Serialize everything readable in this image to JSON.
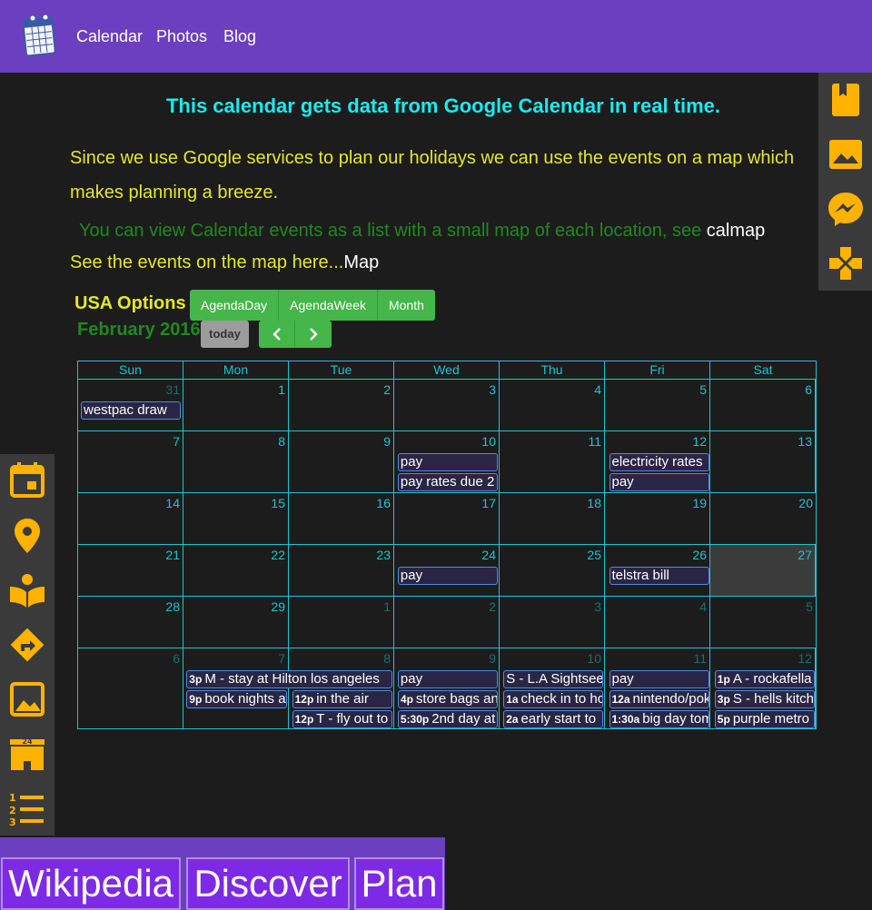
{
  "nav": {
    "links": [
      "Calendar",
      "Photos",
      "Blog"
    ]
  },
  "headline": "This calendar gets data from Google Calendar in real time.",
  "intro": "Since we use Google services to plan our holidays we can use the events on a map which makes planning a breeze.",
  "list_line": {
    "text": "You can view Calendar events as a list with a small map of each location, see ",
    "link": "calmap"
  },
  "map_line": {
    "text": "See the events on the map here...",
    "link": "Map"
  },
  "calendar": {
    "options_label": "USA Options",
    "views": [
      "AgendaDay",
      "AgendaWeek",
      "Month"
    ],
    "title": "February 2016",
    "today_label": "today",
    "weekdays": [
      "Sun",
      "Mon",
      "Tue",
      "Wed",
      "Thu",
      "Fri",
      "Sat"
    ],
    "weeks": [
      {
        "days": [
          {
            "n": "31",
            "other": true
          },
          {
            "n": "1"
          },
          {
            "n": "2"
          },
          {
            "n": "3"
          },
          {
            "n": "4"
          },
          {
            "n": "5"
          },
          {
            "n": "6"
          }
        ],
        "events": [
          {
            "col": 0,
            "lane": 0,
            "title": "westpac draw"
          }
        ]
      },
      {
        "days": [
          {
            "n": "7"
          },
          {
            "n": "8"
          },
          {
            "n": "9"
          },
          {
            "n": "10"
          },
          {
            "n": "11"
          },
          {
            "n": "12"
          },
          {
            "n": "13"
          }
        ],
        "events": [
          {
            "col": 3,
            "lane": 0,
            "title": "pay"
          },
          {
            "col": 3,
            "lane": 1,
            "title": "pay rates due 2"
          },
          {
            "col": 5,
            "lane": 0,
            "title": "electricity rates"
          },
          {
            "col": 5,
            "lane": 1,
            "title": "pay"
          }
        ]
      },
      {
        "days": [
          {
            "n": "14"
          },
          {
            "n": "15"
          },
          {
            "n": "16"
          },
          {
            "n": "17"
          },
          {
            "n": "18"
          },
          {
            "n": "19"
          },
          {
            "n": "20"
          }
        ],
        "events": []
      },
      {
        "days": [
          {
            "n": "21"
          },
          {
            "n": "22"
          },
          {
            "n": "23"
          },
          {
            "n": "24"
          },
          {
            "n": "25"
          },
          {
            "n": "26"
          },
          {
            "n": "27",
            "today": true
          }
        ],
        "events": [
          {
            "col": 3,
            "lane": 0,
            "title": "pay"
          },
          {
            "col": 5,
            "lane": 0,
            "title": "telstra bill"
          }
        ]
      },
      {
        "days": [
          {
            "n": "28"
          },
          {
            "n": "29"
          },
          {
            "n": "1",
            "other": true
          },
          {
            "n": "2",
            "other": true
          },
          {
            "n": "3",
            "other": true
          },
          {
            "n": "4",
            "other": true
          },
          {
            "n": "5",
            "other": true
          }
        ],
        "events": []
      },
      {
        "days": [
          {
            "n": "6",
            "other": true
          },
          {
            "n": "7",
            "other": true
          },
          {
            "n": "8",
            "other": true
          },
          {
            "n": "9",
            "other": true
          },
          {
            "n": "10",
            "other": true
          },
          {
            "n": "11",
            "other": true
          },
          {
            "n": "12",
            "other": true
          }
        ],
        "events": [
          {
            "col": 1,
            "span": 2,
            "lane": 0,
            "time": "3p",
            "title": "M - stay at Hilton los angeles"
          },
          {
            "col": 1,
            "lane": 1,
            "time": "9p",
            "title": "book nights at"
          },
          {
            "col": 2,
            "lane": 1,
            "time": "12p",
            "title": "in the air"
          },
          {
            "col": 2,
            "lane": 2,
            "time": "12p",
            "title": "T - fly out to"
          },
          {
            "col": 3,
            "lane": 0,
            "title": "pay"
          },
          {
            "col": 3,
            "lane": 1,
            "time": "4p",
            "title": "store bags and"
          },
          {
            "col": 3,
            "lane": 2,
            "time": "5:30p",
            "title": "2nd day at"
          },
          {
            "col": 4,
            "lane": 0,
            "title": "S - L.A Sightseeing"
          },
          {
            "col": 4,
            "lane": 1,
            "time": "1a",
            "title": "check in to hotel"
          },
          {
            "col": 4,
            "lane": 2,
            "time": "2a",
            "title": "early start to"
          },
          {
            "col": 5,
            "lane": 0,
            "title": "pay"
          },
          {
            "col": 5,
            "lane": 1,
            "time": "12a",
            "title": "nintendo/pokemon"
          },
          {
            "col": 5,
            "lane": 2,
            "time": "1:30a",
            "title": "big day tomorrow"
          },
          {
            "col": 6,
            "lane": 0,
            "time": "1p",
            "title": "A - rockafella"
          },
          {
            "col": 6,
            "lane": 1,
            "time": "3p",
            "title": "S - hells kitchen"
          },
          {
            "col": 6,
            "lane": 2,
            "time": "5p",
            "title": "purple metro"
          }
        ]
      }
    ]
  },
  "right_icons": [
    "bookmark-icon",
    "image-icon",
    "messenger-icon",
    "game-icon"
  ],
  "left_icons": [
    "calendar-icon",
    "location-pin-icon",
    "reader-icon",
    "directions-icon",
    "image-icon",
    "store-24h-icon",
    "numbered-list-icon"
  ],
  "icon_color": "#ffb300",
  "bottom": {
    "buttons": [
      "Wikipedia",
      "Discover",
      "Plan"
    ]
  }
}
